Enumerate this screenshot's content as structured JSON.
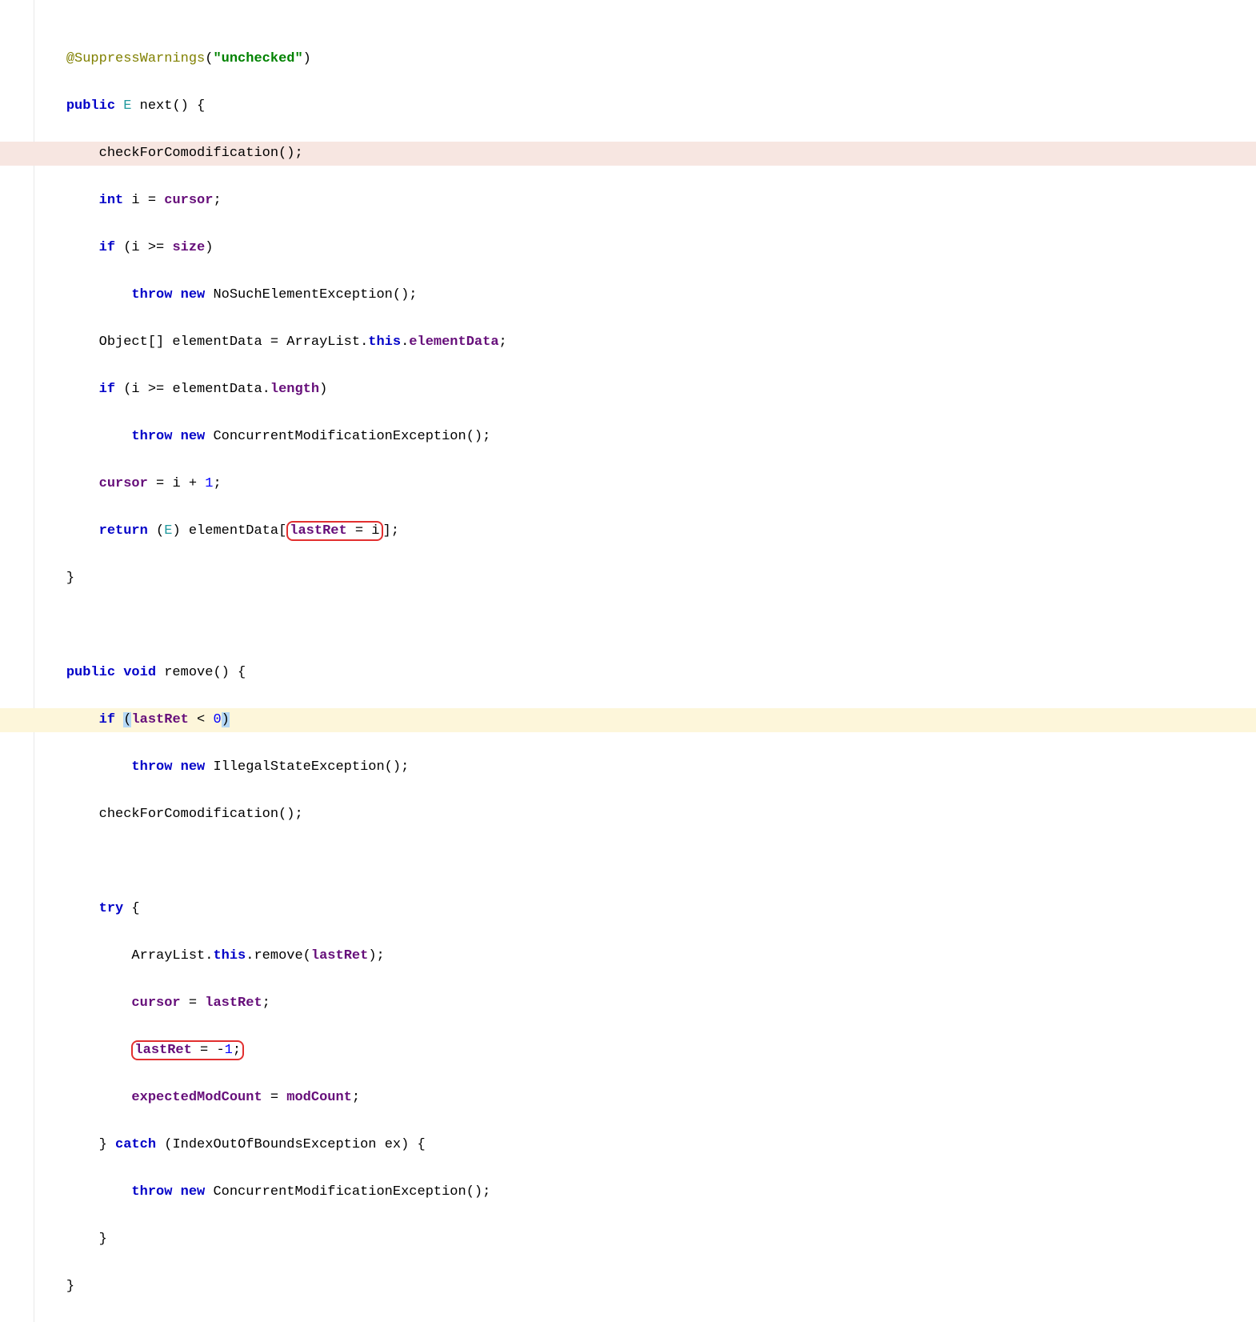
{
  "c": {
    "l1_ann": "@SuppressWarnings",
    "l1_paren1": "(",
    "l1_str": "\"unchecked\"",
    "l1_paren2": ")",
    "l2_pub": "public",
    "l2_E": "E",
    "l2_rest": " next() {",
    "l3": "    checkForComodification();",
    "l4_int": "int",
    "l4_mid": " i = ",
    "l4_cursor": "cursor",
    "l4_semi": ";",
    "l5_if": "if",
    "l5_mid": " (i >= ",
    "l5_size": "size",
    "l5_end": ")",
    "l6_throw": "throw new",
    "l6_rest": " NoSuchElementException();",
    "l7_pre": "    Object[] elementData = ArrayList.",
    "l7_this": "this",
    "l7_dot": ".",
    "l7_ed": "elementData",
    "l7_semi": ";",
    "l8_if": "if",
    "l8_mid": " (i >= elementData.",
    "l8_len": "length",
    "l8_end": ")",
    "l9_throw": "throw new",
    "l9_rest": " ConcurrentModificationException();",
    "l10_cursor": "cursor",
    "l10_rest": " = i + ",
    "l10_one": "1",
    "l10_semi": ";",
    "l11_ret": "return",
    "l11_sp": " (",
    "l11_E": "E",
    "l11_mid": ") elementData[",
    "l11_box_l": "lastRet",
    "l11_box_m": " = i",
    "l11_after": "];",
    "l12": "}",
    "l14_pub": "public void",
    "l14_rest": " remove() {",
    "l15_if": "if",
    "l15_sp": " ",
    "l15_lp": "(",
    "l15_lr": "lastRet",
    "l15_lt": " < ",
    "l15_zero": "0",
    "l15_rp": ")",
    "l16_throw": "throw new",
    "l16_rest": " IllegalStateException();",
    "l17": "    checkForComodification();",
    "l19_try": "try",
    "l19_brace": " {",
    "l20_pre": "        ArrayList.",
    "l20_this": "this",
    "l20_mid": ".remove(",
    "l20_lr": "lastRet",
    "l20_end": ");",
    "l21_cursor": "cursor",
    "l21_eq": " = ",
    "l21_lr": "lastRet",
    "l21_semi": ";",
    "l22_lr": "lastRet",
    "l22_eq": " = -",
    "l22_one": "1",
    "l22_semi": ";",
    "l23_emc": "expectedModCount",
    "l23_eq": " = ",
    "l23_mc": "modCount",
    "l23_semi": ";",
    "l24_rb": "    } ",
    "l24_catch": "catch",
    "l24_rest": " (IndexOutOfBoundsException ex) {",
    "l25_throw": "throw new",
    "l25_rest": " ConcurrentModificationException();",
    "l26": "    }",
    "l27": "}"
  }
}
